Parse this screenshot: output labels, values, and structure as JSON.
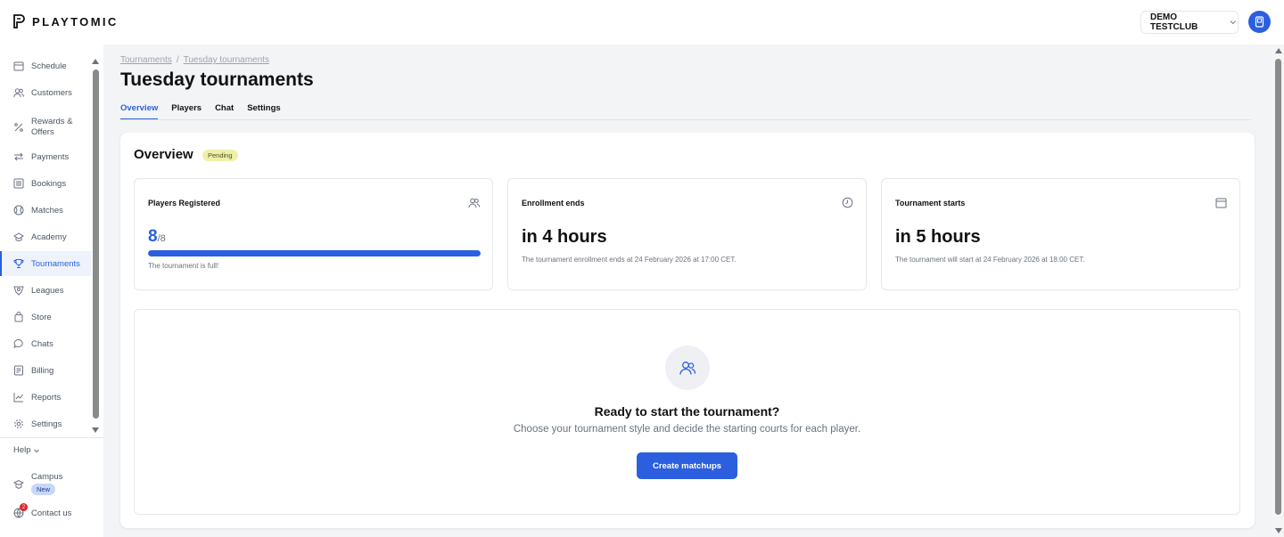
{
  "app": {
    "brand": "PLAYTOMIC",
    "club": "DEMO TESTCLUB"
  },
  "colors": {
    "accent": "#2b5fe0",
    "pending_bg": "#eef0a9",
    "notification": "#dc2626"
  },
  "sidebar": {
    "items": [
      {
        "label": "Schedule",
        "icon": "calendar-icon"
      },
      {
        "label": "Customers",
        "icon": "users-icon"
      },
      {
        "label": "Rewards &",
        "label2": "Offers",
        "icon": "percent-icon"
      },
      {
        "label": "Payments",
        "icon": "arrows-icon"
      },
      {
        "label": "Bookings",
        "icon": "list-icon"
      },
      {
        "label": "Matches",
        "icon": "ball-icon"
      },
      {
        "label": "Academy",
        "icon": "academy-icon"
      },
      {
        "label": "Tournaments",
        "icon": "trophy-icon",
        "active": true
      },
      {
        "label": "Leagues",
        "icon": "leagues-icon"
      },
      {
        "label": "Store",
        "icon": "bag-icon"
      },
      {
        "label": "Chats",
        "icon": "chat-icon"
      },
      {
        "label": "Billing",
        "icon": "billing-icon"
      },
      {
        "label": "Reports",
        "icon": "chart-icon"
      },
      {
        "label": "Settings",
        "icon": "gear-icon"
      }
    ],
    "help": "Help",
    "campus": "Campus",
    "campus_badge": "New",
    "contact": "Contact us",
    "contact_notifications": "2"
  },
  "breadcrumb": {
    "root": "Tournaments",
    "separator": "/",
    "current": "Tuesday tournaments"
  },
  "page_title": "Tuesday tournaments",
  "tabs": [
    {
      "label": "Overview",
      "active": true
    },
    {
      "label": "Players"
    },
    {
      "label": "Chat"
    },
    {
      "label": "Settings"
    }
  ],
  "overview": {
    "title": "Overview",
    "status": "Pending",
    "players": {
      "label": "Players Registered",
      "count": "8",
      "total": "/8",
      "progress_percent": 100,
      "note": "The tournament is full!"
    },
    "enrollment": {
      "label": "Enrollment ends",
      "value": "in 4 hours",
      "note": "The tournament enrollment ends at 24 February 2026 at 17:00 CET."
    },
    "start": {
      "label": "Tournament starts",
      "value": "in 5 hours",
      "note": "The tournament will start at 24 February 2026 at 18:00 CET."
    }
  },
  "ready": {
    "title": "Ready to start the tournament?",
    "subtitle": "Choose your tournament style and decide the starting courts for each player.",
    "button": "Create matchups"
  }
}
